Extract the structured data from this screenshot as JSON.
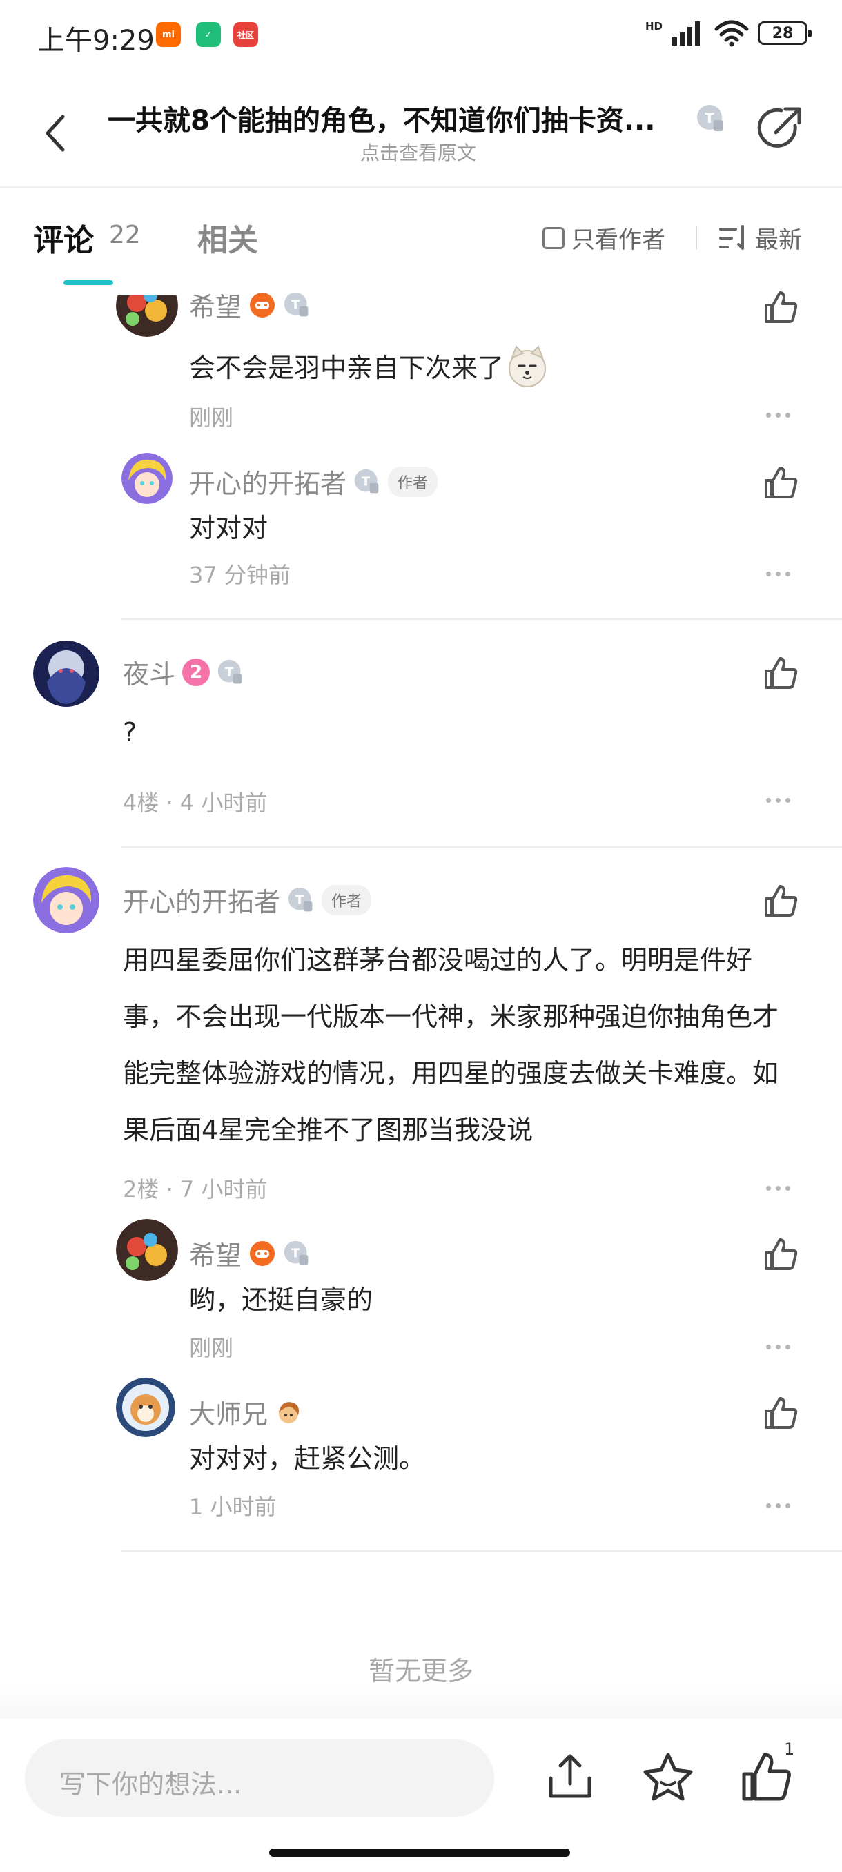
{
  "status_bar": {
    "time": "上午9:29",
    "app_badges": [
      {
        "label": "mi",
        "color": "#ff6a00"
      },
      {
        "label": "✓",
        "color": "#1fbf7a"
      },
      {
        "label": "社区",
        "color": "#e8403a"
      }
    ],
    "network_label": "HD",
    "battery": "28"
  },
  "header": {
    "title": "一共就8个能抽的角色，不知道你们抽卡资...",
    "subtitle": "点击查看原文"
  },
  "tabs": {
    "comments_label": "评论",
    "comments_count": "22",
    "related_label": "相关",
    "author_only_label": "只看作者",
    "sort_label": "最新"
  },
  "comments": {
    "reply_xiwang_1": {
      "name": "希望",
      "text": "会不会是羽中亲自下次来了",
      "time": "刚刚"
    },
    "reply_author_1": {
      "name": "开心的开拓者",
      "author_tag": "作者",
      "text": "对对对",
      "time": "37 分钟前"
    },
    "yedou": {
      "name": "夜斗",
      "level": "2",
      "text": "?",
      "meta": "4楼 · 4 小时前"
    },
    "author_main": {
      "name": "开心的开拓者",
      "author_tag": "作者",
      "text": "用四星委屈你们这群茅台都没喝过的人了。明明是件好事，不会出现一代版本一代神，米家那种强迫你抽角色才能完整体验游戏的情况，用四星的强度去做关卡难度。如果后面4星完全推不了图那当我没说",
      "meta": "2楼 · 7 小时前"
    },
    "reply_xiwang_2": {
      "name": "希望",
      "text": "哟，还挺自豪的",
      "time": "刚刚"
    },
    "reply_dashixiong": {
      "name": "大师兄",
      "text": "对对对，赶紧公测。",
      "time": "1 小时前"
    }
  },
  "footer": {
    "no_more": "暂无更多"
  },
  "bottom_bar": {
    "placeholder": "写下你的想法...",
    "like_count": "1"
  },
  "colors": {
    "accent": "#1fc1c6",
    "badge_orange": "#f26b21",
    "level_pink": "#f472a8"
  }
}
